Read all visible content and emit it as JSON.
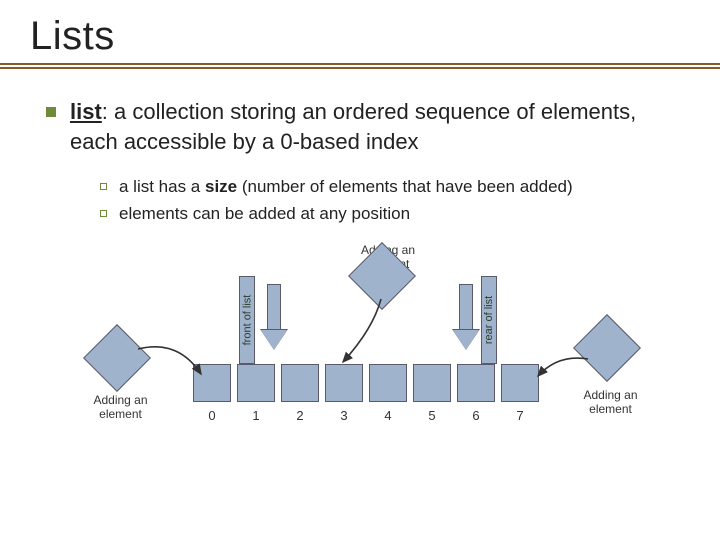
{
  "title": "Lists",
  "definition": {
    "term": "list",
    "text_after_term": ": a collection storing an ordered sequence of elements,",
    "text_line2": "each accessible by a 0-based index"
  },
  "sub_points": [
    {
      "pre": "a list has a ",
      "bold": "size",
      "post": " (number of elements that have been added)"
    },
    {
      "pre": "elements can be added at any position",
      "bold": "",
      "post": ""
    }
  ],
  "diagram": {
    "top_label": "Adding an\nelement",
    "left_label": "Adding an\nelement",
    "right_label": "Adding an\nelement",
    "front_label": "front of list",
    "rear_label": "rear of list",
    "indices": [
      "0",
      "1",
      "2",
      "3",
      "4",
      "5",
      "6",
      "7"
    ]
  }
}
